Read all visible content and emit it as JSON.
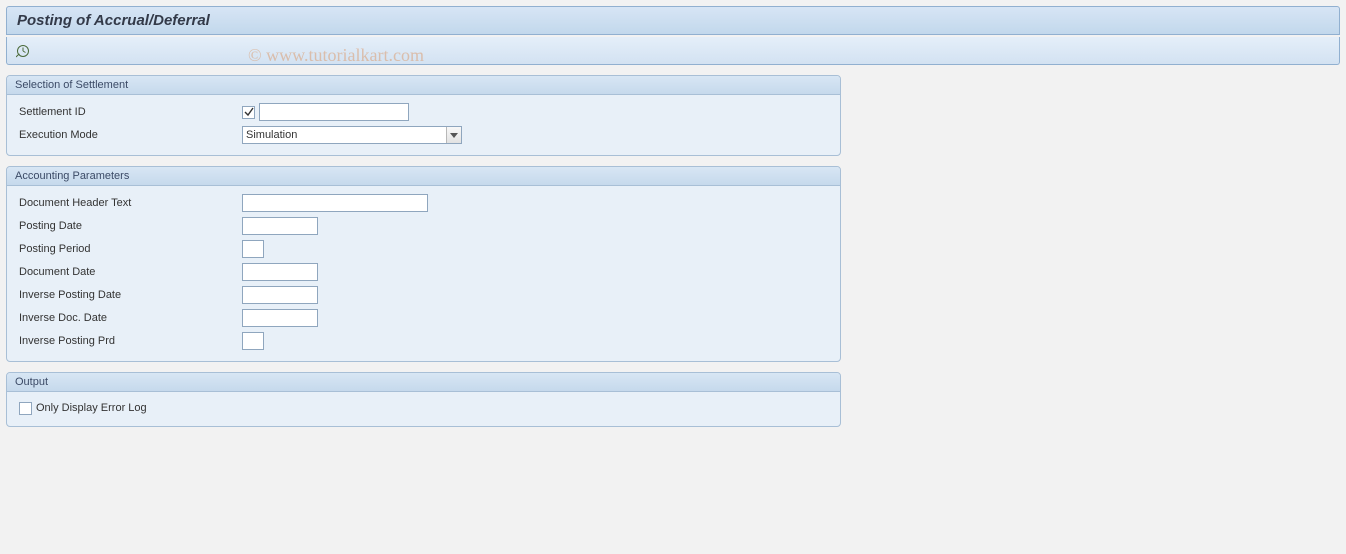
{
  "title": "Posting of Accrual/Deferral",
  "watermark": "© www.tutorialkart.com",
  "groups": {
    "selection": {
      "title": "Selection of Settlement",
      "settlement_id_label": "Settlement ID",
      "settlement_id_checked": true,
      "settlement_id_value": "",
      "execution_mode_label": "Execution Mode",
      "execution_mode_value": "Simulation"
    },
    "accounting": {
      "title": "Accounting Parameters",
      "doc_header_label": "Document Header Text",
      "doc_header_value": "",
      "posting_date_label": "Posting Date",
      "posting_date_value": "",
      "posting_period_label": "Posting Period",
      "posting_period_value": "",
      "document_date_label": "Document Date",
      "document_date_value": "",
      "inverse_posting_date_label": "Inverse Posting Date",
      "inverse_posting_date_value": "",
      "inverse_doc_date_label": "Inverse Doc. Date",
      "inverse_doc_date_value": "",
      "inverse_posting_prd_label": "Inverse Posting Prd",
      "inverse_posting_prd_value": ""
    },
    "output": {
      "title": "Output",
      "only_display_error_label": "Only Display Error Log",
      "only_display_error_checked": false
    }
  }
}
